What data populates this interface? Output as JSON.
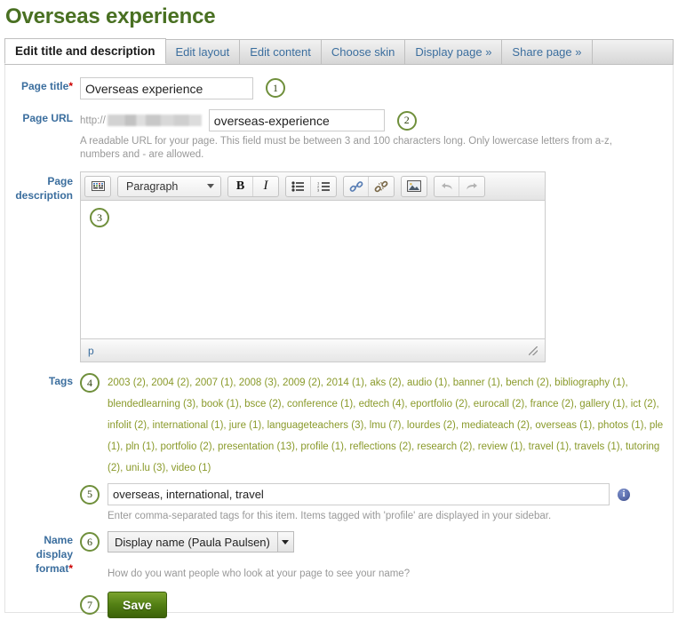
{
  "page": {
    "heading": "Overseas experience"
  },
  "tabs": [
    {
      "label": "Edit title and description",
      "active": true
    },
    {
      "label": "Edit layout",
      "active": false
    },
    {
      "label": "Edit content",
      "active": false
    },
    {
      "label": "Choose skin",
      "active": false
    },
    {
      "label": "Display page »",
      "active": false
    },
    {
      "label": "Share page »",
      "active": false
    }
  ],
  "form": {
    "page_title": {
      "label": "Page title",
      "required": "*",
      "value": "Overseas experience",
      "marker": "1"
    },
    "page_url": {
      "label": "Page URL",
      "protocol": "http://",
      "value": "overseas-experience",
      "marker": "2",
      "help": "A readable URL for your page. This field must be between 3 and 100 characters long. Only lowercase letters from a-z, numbers and - are allowed."
    },
    "page_description": {
      "label": "Page description",
      "marker": "3",
      "body_text": "",
      "status_path": "p",
      "toolbar": {
        "fullscreen_label": "keyboard-icon",
        "format_select": "Paragraph",
        "bold": "B",
        "italic": "I",
        "bullet_list": "unordered-list-icon",
        "number_list": "ordered-list-icon",
        "link": "link-icon",
        "unlink": "unlink-icon",
        "image": "image-icon",
        "undo": "undo-icon",
        "redo": "redo-icon"
      }
    },
    "tags": {
      "label": "Tags",
      "marker_cloud": "4",
      "marker_input": "5",
      "input_value": "overseas, international, travel",
      "help": "Enter comma-separated tags for this item. Items tagged with 'profile' are displayed in your sidebar.",
      "info_icon_label": "i",
      "cloud": [
        {
          "name": "2003",
          "count": "(2)"
        },
        {
          "name": "2004",
          "count": "(2)"
        },
        {
          "name": "2007",
          "count": "(1)"
        },
        {
          "name": "2008",
          "count": "(3)"
        },
        {
          "name": "2009",
          "count": "(2)"
        },
        {
          "name": "2014",
          "count": "(1)"
        },
        {
          "name": "aks",
          "count": "(2)"
        },
        {
          "name": "audio",
          "count": "(1)"
        },
        {
          "name": "banner",
          "count": "(1)"
        },
        {
          "name": "bench",
          "count": "(2)"
        },
        {
          "name": "bibliography",
          "count": "(1)"
        },
        {
          "name": "blendedlearning",
          "count": "(3)"
        },
        {
          "name": "book",
          "count": "(1)"
        },
        {
          "name": "bsce",
          "count": "(2)"
        },
        {
          "name": "conference",
          "count": "(1)"
        },
        {
          "name": "edtech",
          "count": "(4)"
        },
        {
          "name": "eportfolio",
          "count": "(2)"
        },
        {
          "name": "eurocall",
          "count": "(2)"
        },
        {
          "name": "france",
          "count": "(2)"
        },
        {
          "name": "gallery",
          "count": "(1)"
        },
        {
          "name": "ict",
          "count": "(2)"
        },
        {
          "name": "infolit",
          "count": "(2)"
        },
        {
          "name": "international",
          "count": "(1)"
        },
        {
          "name": "jure",
          "count": "(1)"
        },
        {
          "name": "languageteachers",
          "count": "(3)"
        },
        {
          "name": "lmu",
          "count": "(7)"
        },
        {
          "name": "lourdes",
          "count": "(2)"
        },
        {
          "name": "mediateach",
          "count": "(2)"
        },
        {
          "name": "overseas",
          "count": "(1)"
        },
        {
          "name": "photos",
          "count": "(1)"
        },
        {
          "name": "ple",
          "count": "(1)"
        },
        {
          "name": "pln",
          "count": "(1)"
        },
        {
          "name": "portfolio",
          "count": "(2)"
        },
        {
          "name": "presentation",
          "count": "(13)"
        },
        {
          "name": "profile",
          "count": "(1)"
        },
        {
          "name": "reflections",
          "count": "(2)"
        },
        {
          "name": "research",
          "count": "(2)"
        },
        {
          "name": "review",
          "count": "(1)"
        },
        {
          "name": "travel",
          "count": "(1)"
        },
        {
          "name": "travels",
          "count": "(1)"
        },
        {
          "name": "tutoring",
          "count": "(2)"
        },
        {
          "name": "uni.lu",
          "count": "(3)"
        },
        {
          "name": "video",
          "count": "(1)"
        }
      ]
    },
    "name_display_format": {
      "label": "Name display format",
      "required": "*",
      "marker": "6",
      "value": "Display name (Paula Paulsen)",
      "help": "How do you want people who look at your page to see your name?"
    },
    "save": {
      "marker": "7",
      "label": "Save"
    }
  },
  "colors": {
    "heading_green": "#497022",
    "label_blue": "#3b6e9e",
    "tag_olive": "#8a9a2b",
    "marker_ring": "#6f8f3b",
    "save_green": "#538014",
    "required_red": "#cc0000"
  }
}
